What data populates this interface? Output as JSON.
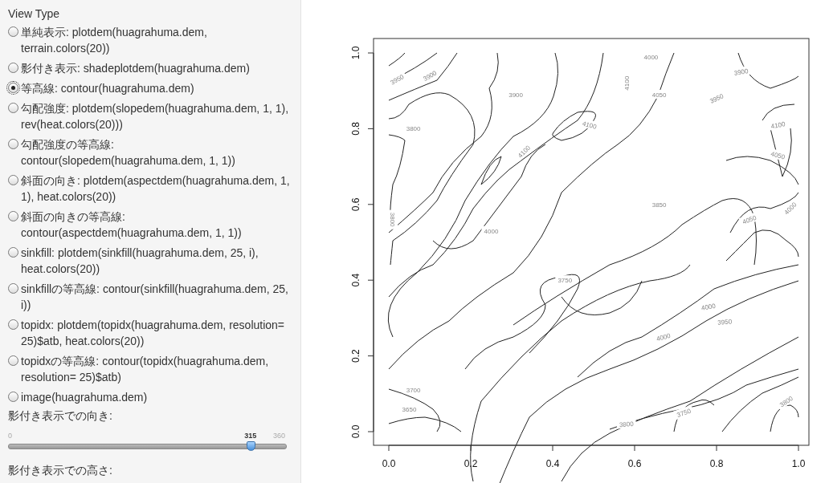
{
  "sidebar": {
    "view_type": {
      "label": "View Type",
      "options": [
        {
          "label": "単純表示: plotdem(huagrahuma.dem, terrain.colors(20))",
          "selected": false
        },
        {
          "label": "影付き表示: shadeplotdem(huagrahuma.dem)",
          "selected": false
        },
        {
          "label": "等高線: contour(huagrahuma.dem)",
          "selected": true
        },
        {
          "label": "勾配強度: plotdem(slopedem(huagrahuma.dem, 1, 1), rev(heat.colors(20)))",
          "selected": false
        },
        {
          "label": "勾配強度の等高線: contour(slopedem(huagrahuma.dem, 1, 1))",
          "selected": false
        },
        {
          "label": "斜面の向き: plotdem(aspectdem(huagrahuma.dem, 1, 1), heat.colors(20))",
          "selected": false
        },
        {
          "label": "斜面の向きの等高線: contour(aspectdem(huagrahuma.dem, 1, 1))",
          "selected": false
        },
        {
          "label": "sinkfill: plotdem(sinkfill(huagrahuma.dem, 25, i), heat.colors(20))",
          "selected": false
        },
        {
          "label": "sinkfillの等高線: contour(sinkfill(huagrahuma.dem, 25, i))",
          "selected": false
        },
        {
          "label": "topidx: plotdem(topidx(huagrahuma.dem, resolution= 25)$atb, heat.colors(20))",
          "selected": false
        },
        {
          "label": "topidxの等高線: contour(topidx(huagrahuma.dem, resolution= 25)$atb)",
          "selected": false
        },
        {
          "label": "image(huagrahuma.dem)",
          "selected": false
        }
      ]
    },
    "direction_slider": {
      "label": "影付き表示での向き:",
      "min": "0",
      "max": "360",
      "value": "315",
      "level": 0.875
    },
    "height_label": "影付き表示での高さ:"
  },
  "plot": {
    "xticks": [
      "0.0",
      "0.2",
      "0.4",
      "0.6",
      "0.8",
      "1.0"
    ],
    "yticks": [
      "0.0",
      "0.2",
      "0.4",
      "0.6",
      "0.8",
      "1.0"
    ],
    "contour_labels": [
      "3950",
      "3900",
      "3900",
      "4000",
      "4100",
      "4050",
      "3900",
      "3950",
      "3800",
      "4100",
      "4100",
      "4100",
      "4050",
      "3850",
      "3800",
      "4000",
      "4050",
      "4000",
      "3750",
      "4000",
      "3950",
      "4000",
      "3700",
      "3650",
      "3800",
      "3750",
      "3800"
    ]
  }
}
